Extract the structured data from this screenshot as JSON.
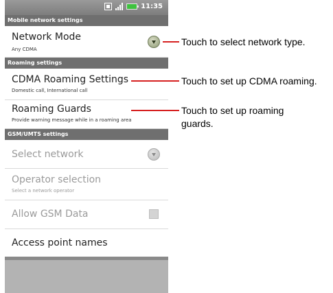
{
  "status_bar": {
    "time": "11:35",
    "icons": [
      "photo-icon",
      "signal-icon",
      "battery-icon"
    ]
  },
  "sections": {
    "mobile": "Mobile network settings",
    "roaming": "Roaming settings",
    "gsm": "GSM/UMTS settings"
  },
  "rows": {
    "network_mode": {
      "title": "Network Mode",
      "subtitle": "Any CDMA"
    },
    "cdma_roaming": {
      "title": "CDMA Roaming Settings",
      "subtitle": "Domestic call, International call"
    },
    "roaming_guards": {
      "title": "Roaming Guards",
      "subtitle": "Provide warning message while in a roaming area"
    },
    "select_network": {
      "title": "Select network"
    },
    "operator_selection": {
      "title": "Operator selection",
      "subtitle": "Select a network operator"
    },
    "allow_gsm_data": {
      "title": "Allow GSM Data"
    },
    "access_point_names": {
      "title": "Access point names"
    }
  },
  "callouts": {
    "network_type": "Touch to select network type.",
    "cdma_roaming": "Touch to set up CDMA roaming.",
    "roaming_guards_line1": "Touch to set up roaming",
    "roaming_guards_line2": "guards."
  },
  "colors": {
    "callout_line": "#d61f1f",
    "section_header": "#6f6f6f",
    "battery": "#3ec23e"
  }
}
